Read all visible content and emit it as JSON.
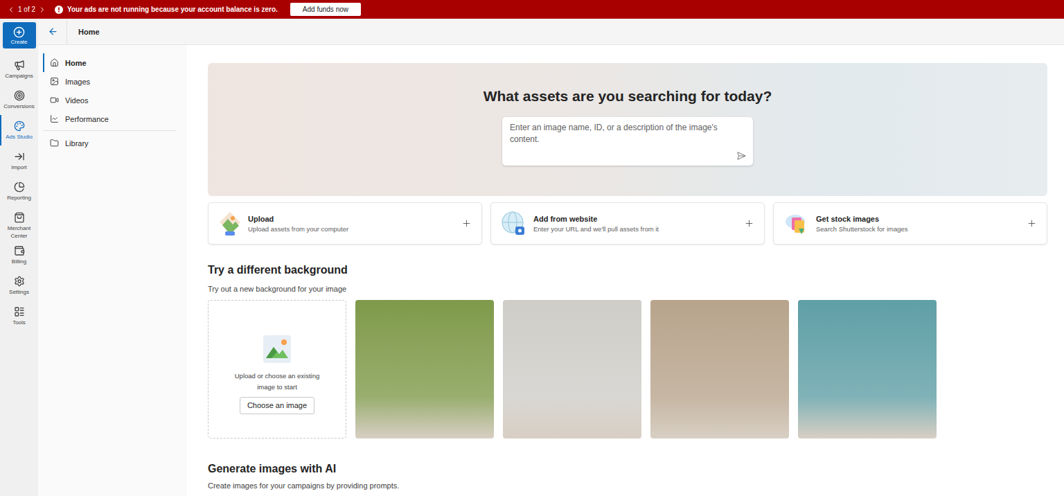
{
  "banner": {
    "pager": "1 of 2",
    "message": "Your ads are not running because your account balance is zero.",
    "button": "Add funds now"
  },
  "rail": {
    "create": "Create",
    "items": [
      {
        "label": "Campaigns",
        "selected": false
      },
      {
        "label": "Conversions",
        "selected": false
      },
      {
        "label": "Ads Studio",
        "selected": true
      },
      {
        "label": "Import",
        "selected": false
      },
      {
        "label": "Reporting",
        "selected": false
      },
      {
        "label": "Merchant Center",
        "selected": false
      },
      {
        "label": "Billing",
        "selected": false
      },
      {
        "label": "Settings",
        "selected": false
      },
      {
        "label": "Tools",
        "selected": false
      }
    ]
  },
  "header": {
    "title": "Home"
  },
  "subnav": {
    "items": [
      {
        "label": "Home",
        "selected": true
      },
      {
        "label": "Images",
        "selected": false
      },
      {
        "label": "Videos",
        "selected": false
      },
      {
        "label": "Performance",
        "selected": false
      }
    ],
    "library": {
      "label": "Library",
      "selected": false
    }
  },
  "hero": {
    "title": "What assets are you searching for today?",
    "search_placeholder": "Enter an image name, ID, or a description of the image's content."
  },
  "actions": [
    {
      "title": "Upload",
      "subtitle": "Upload assets from your computer"
    },
    {
      "title": "Add from website",
      "subtitle": "Enter your URL and we'll pull assets from it"
    },
    {
      "title": "Get stock images",
      "subtitle": "Search Shutterstock for images"
    }
  ],
  "backgrounds": {
    "title": "Try a different background",
    "subtitle": "Try out a new background for your image",
    "upload_text": "Upload or choose an existing image to start",
    "upload_button": "Choose an image",
    "samples": [
      {
        "color": "#7f9a4a"
      },
      {
        "color": "#cfcdc8"
      },
      {
        "color": "#b8a48c"
      },
      {
        "color": "#5f9fa6"
      }
    ]
  },
  "generate": {
    "title": "Generate images with AI",
    "subtitle": "Create images for your campaigns by providing prompts."
  }
}
